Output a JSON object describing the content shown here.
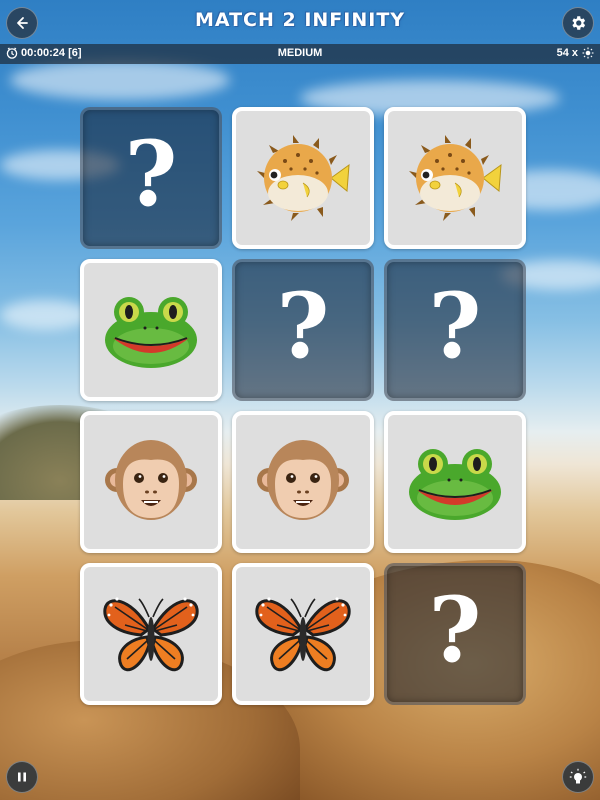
{
  "header": {
    "title": "MATCH 2 INFINITY"
  },
  "status": {
    "timer": "00:00:24 [6]",
    "difficulty": "MEDIUM",
    "hints": "54 x"
  },
  "board": {
    "rows": 4,
    "cols": 3,
    "cards": [
      {
        "state": "hidden",
        "symbol": "?"
      },
      {
        "state": "revealed",
        "icon": "pufferfish"
      },
      {
        "state": "revealed",
        "icon": "pufferfish"
      },
      {
        "state": "revealed",
        "icon": "frog"
      },
      {
        "state": "hidden",
        "symbol": "?"
      },
      {
        "state": "hidden",
        "symbol": "?"
      },
      {
        "state": "revealed",
        "icon": "monkey"
      },
      {
        "state": "revealed",
        "icon": "monkey"
      },
      {
        "state": "revealed",
        "icon": "frog"
      },
      {
        "state": "revealed",
        "icon": "butterfly"
      },
      {
        "state": "revealed",
        "icon": "butterfly"
      },
      {
        "state": "hidden",
        "symbol": "?"
      }
    ]
  },
  "colors": {
    "accent": "#2a64a8",
    "card_face": "#dedede",
    "card_border": "#ffffff",
    "card_back": "#1e2d3c"
  }
}
